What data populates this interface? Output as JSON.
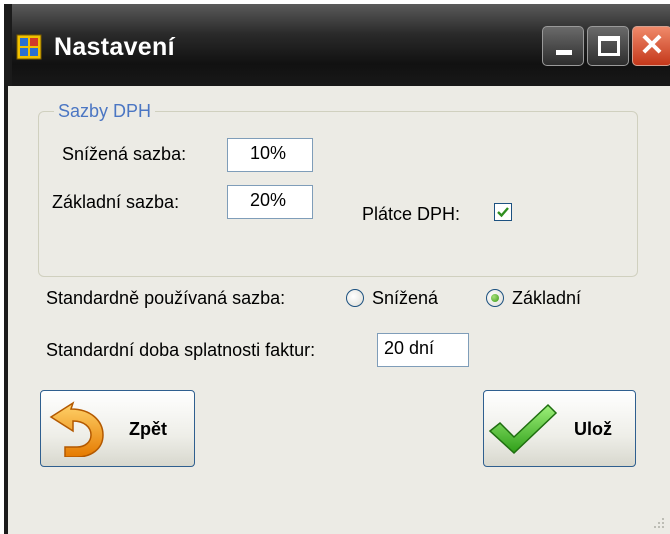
{
  "window": {
    "title": "Nastavení"
  },
  "group": {
    "title": "Sazby DPH"
  },
  "fields": {
    "reduced_label": "Snížená sazba:",
    "reduced_value": "10%",
    "basic_label": "Základní sazba:",
    "basic_value": "20%",
    "vat_payer_label": "Plátce DPH:",
    "vat_payer_checked": true
  },
  "default_rate": {
    "label": "Standardně používaná sazba:",
    "options": [
      {
        "label": "Snížená",
        "selected": false
      },
      {
        "label": "Základní",
        "selected": true
      }
    ]
  },
  "due": {
    "label": "Standardní doba splatnosti faktur:",
    "value": "20 dní"
  },
  "buttons": {
    "back": "Zpět",
    "save": "Ulož"
  },
  "colors": {
    "group_title": "#4b76c3",
    "check": "#2f8f1f",
    "back_arrow": "#f39c12",
    "save_check": "#3cb521"
  }
}
